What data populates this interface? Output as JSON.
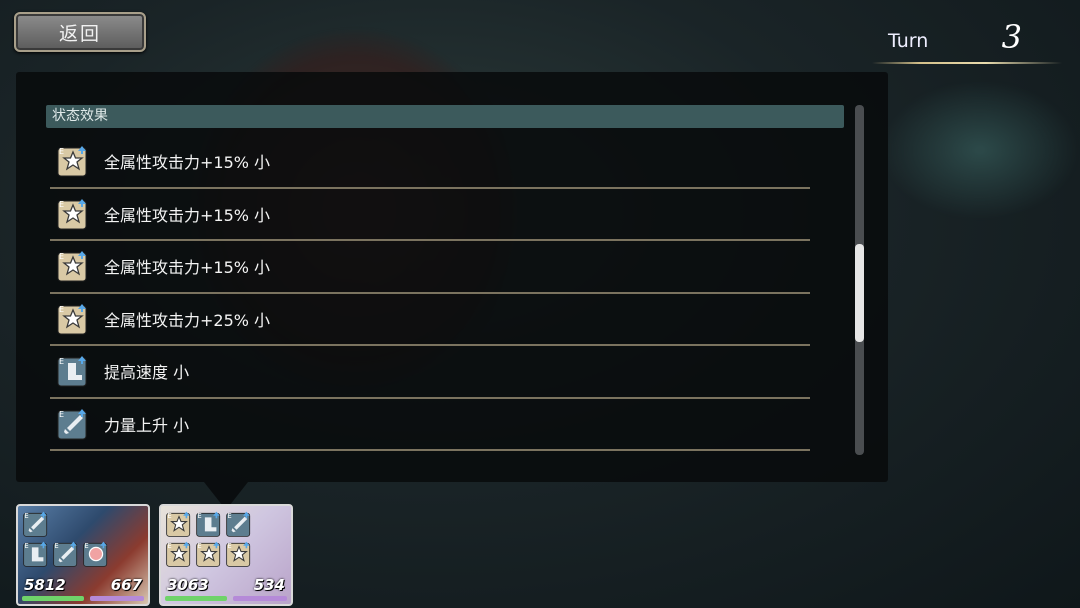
{
  "header": {
    "back_label": "返回",
    "turn_label": "Turn",
    "turn_value": "3"
  },
  "panel": {
    "section_title": "状态效果",
    "scroll_position": 0.55,
    "effects": [
      {
        "label": "全属性攻击力+15% 小",
        "icon": "attack-up-star-icon"
      },
      {
        "label": "全属性攻击力+15% 小",
        "icon": "attack-up-star-icon"
      },
      {
        "label": "全属性攻击力+15% 小",
        "icon": "attack-up-star-icon"
      },
      {
        "label": "全属性攻击力+25% 小",
        "icon": "attack-up-star-icon"
      },
      {
        "label": "提高速度 小",
        "icon": "speed-boot-icon"
      },
      {
        "label": "力量上升 小",
        "icon": "sword-up-icon"
      }
    ]
  },
  "party": [
    {
      "hp": "5812",
      "sp": "667",
      "icons": [
        "sword-up-icon",
        "speed-boot-icon",
        "sword-up-icon",
        "orb-icon"
      ]
    },
    {
      "hp": "3063",
      "sp": "534",
      "icons": [
        "attack-up-star-icon",
        "speed-boot-icon",
        "sword-up-icon",
        "attack-up-star-icon",
        "attack-up-star-icon",
        "attack-up-star-icon"
      ]
    }
  ],
  "colors": {
    "section_header": "#3c5a5c",
    "row_divider": "#7b735f",
    "hp_bar": "#6fd36a",
    "sp_bar": "#b58ad8"
  }
}
